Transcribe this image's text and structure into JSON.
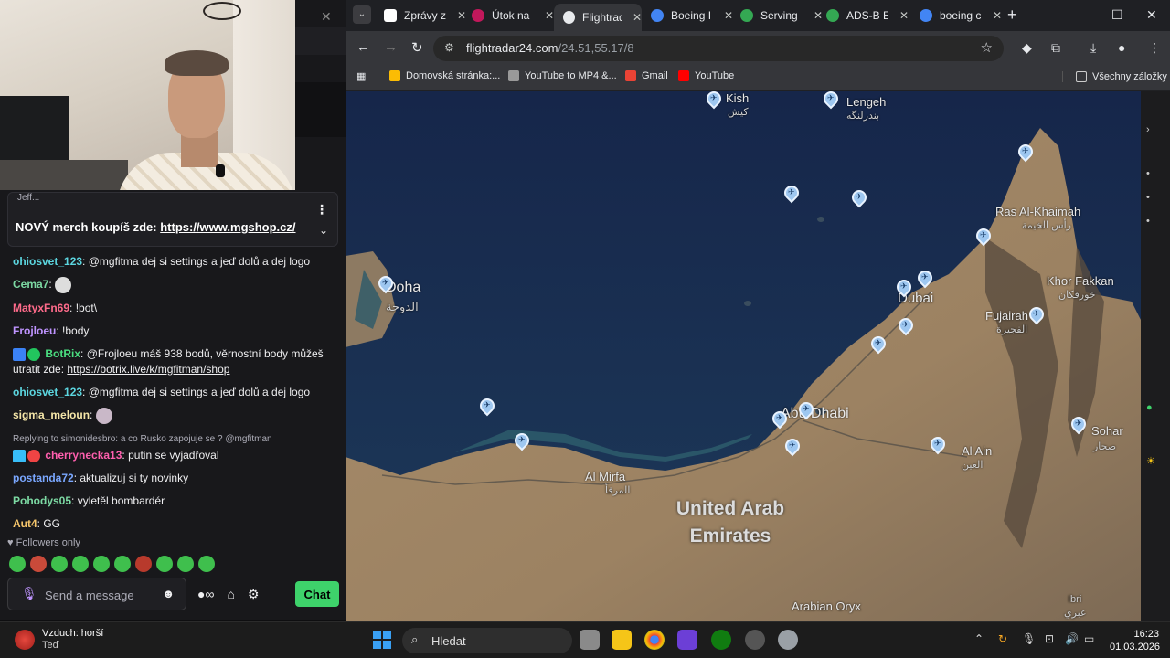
{
  "chat": {
    "pinned_partial": "Jeff...",
    "pinned_message": "NOVÝ merch koupíš zde:",
    "pinned_link": "https://www.mgshop.cz/",
    "messages": [
      {
        "user": "ohiosvet_123",
        "color": "#5cd6e0",
        "text": "@mgfitma dej si settings a jeď dolů a dej logo"
      },
      {
        "user": "Cema7",
        "color": "#7cd9a3",
        "text": ""
      },
      {
        "user": "MatyxFn69",
        "color": "#ff6b8b",
        "text": "!bot\\"
      },
      {
        "user": "Frojloeu",
        "color": "#bf94ff",
        "text": "!body"
      },
      {
        "user": "BotRix",
        "color": "#4ade80",
        "text": "@Frojloeu máš 938 bodů, věrnostní body můžeš utratit zde:",
        "link": "https://botrix.live/k/mgfitman/shop"
      },
      {
        "user": "ohiosvet_123",
        "color": "#5cd6e0",
        "text": "@mgfitma dej si settings a jeď dolů a dej logo"
      },
      {
        "user": "sigma_meloun",
        "color": "#f5e6a8",
        "text": ""
      },
      {
        "user": "cherrynecka13",
        "color": "#ff5fae",
        "reply_to": "Replying to simonidesbro: a co Rusko zapojuje se ? @mgfitman",
        "text": "putin se vyjadřoval"
      },
      {
        "user": "postanda72",
        "color": "#7aa7ff",
        "text": "aktualizuj si ty novinky"
      },
      {
        "user": "Pohodys05",
        "color": "#7cd9a3",
        "text": "vyletěl bombardér"
      },
      {
        "user": "Aut4",
        "color": "#f5c56b",
        "text": "GG"
      }
    ],
    "followers_only": "Followers only",
    "input_placeholder": "Send a message",
    "chat_button": "Chat"
  },
  "browser": {
    "tabs": [
      {
        "title": "Zprávy z",
        "color": "#ffffff"
      },
      {
        "title": "Útok na",
        "color": "#c2185b"
      },
      {
        "title": "Flightrad",
        "color": "#e8eaed"
      },
      {
        "title": "Boeing I",
        "color": "#4285f4"
      },
      {
        "title": "Serving",
        "color": "#34a853"
      },
      {
        "title": "ADS-B E",
        "color": "#34a853"
      },
      {
        "title": "boeing c",
        "color": "#4285f4"
      }
    ],
    "url_host": "flightradar24.com",
    "url_path": "/24.51,55.17/8",
    "bookmarks": [
      "Domovská stránka:...",
      "YouTube to MP4 &...",
      "Gmail",
      "YouTube"
    ],
    "all_bookmarks": "Všechny záložky"
  },
  "map": {
    "labels": {
      "kish": "Kish",
      "kish_ar": "كيش",
      "lengeh": "Lengeh",
      "lengeh_ar": "بندرلنگه",
      "doha": "Doha",
      "doha_ar": "الدوحة",
      "ras": "Ras Al-Khaimah",
      "ras_ar": "رأس الخيمة",
      "khor": "Khor Fakkan",
      "khor_ar": "خورفكان",
      "dubai": "Dubai",
      "fujairah": "Fujairah",
      "fujairah_ar": "الفجيرة",
      "abudhabi": "Abu Dhabi",
      "alain": "Al Ain",
      "alain_ar": "العين",
      "sohar": "Sohar",
      "sohar_ar": "صحار",
      "almirfa": "Al Mirfa",
      "almirfa_ar": "المرفأ",
      "uae": "United Arab Emirates",
      "oryx": "Arabian Oryx",
      "ibri": "Ibri",
      "ibri_ar": "عبري"
    }
  },
  "taskbar": {
    "weather_title": "Vzduch: horší",
    "weather_sub": "Teď",
    "search": "Hledat",
    "time": "16:23",
    "date": "01.03.2026"
  }
}
